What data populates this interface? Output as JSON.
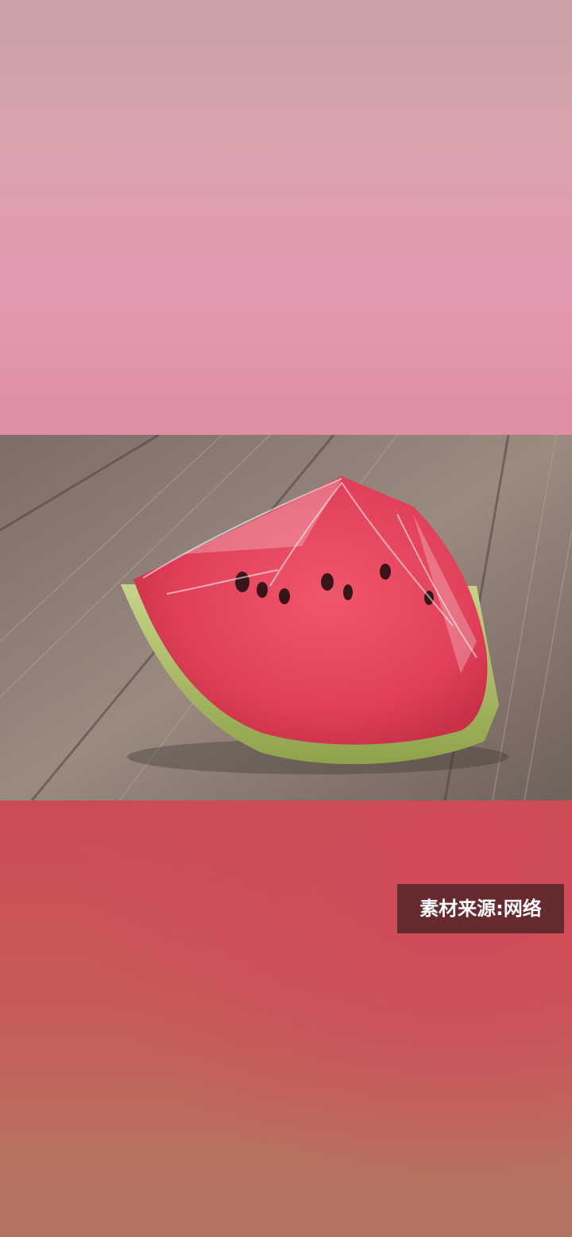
{
  "watermark": {
    "text": "素材来源:网络"
  },
  "photo": {
    "subject": "watermelon-slice-wrapped-in-plastic-film-on-wooden-table"
  },
  "colors": {
    "top_bg": "#e39ab0",
    "bottom_bg": "#cc4c55",
    "flesh": "#e0405a",
    "rind": "#a8b860",
    "wood": "#8a7a70"
  }
}
